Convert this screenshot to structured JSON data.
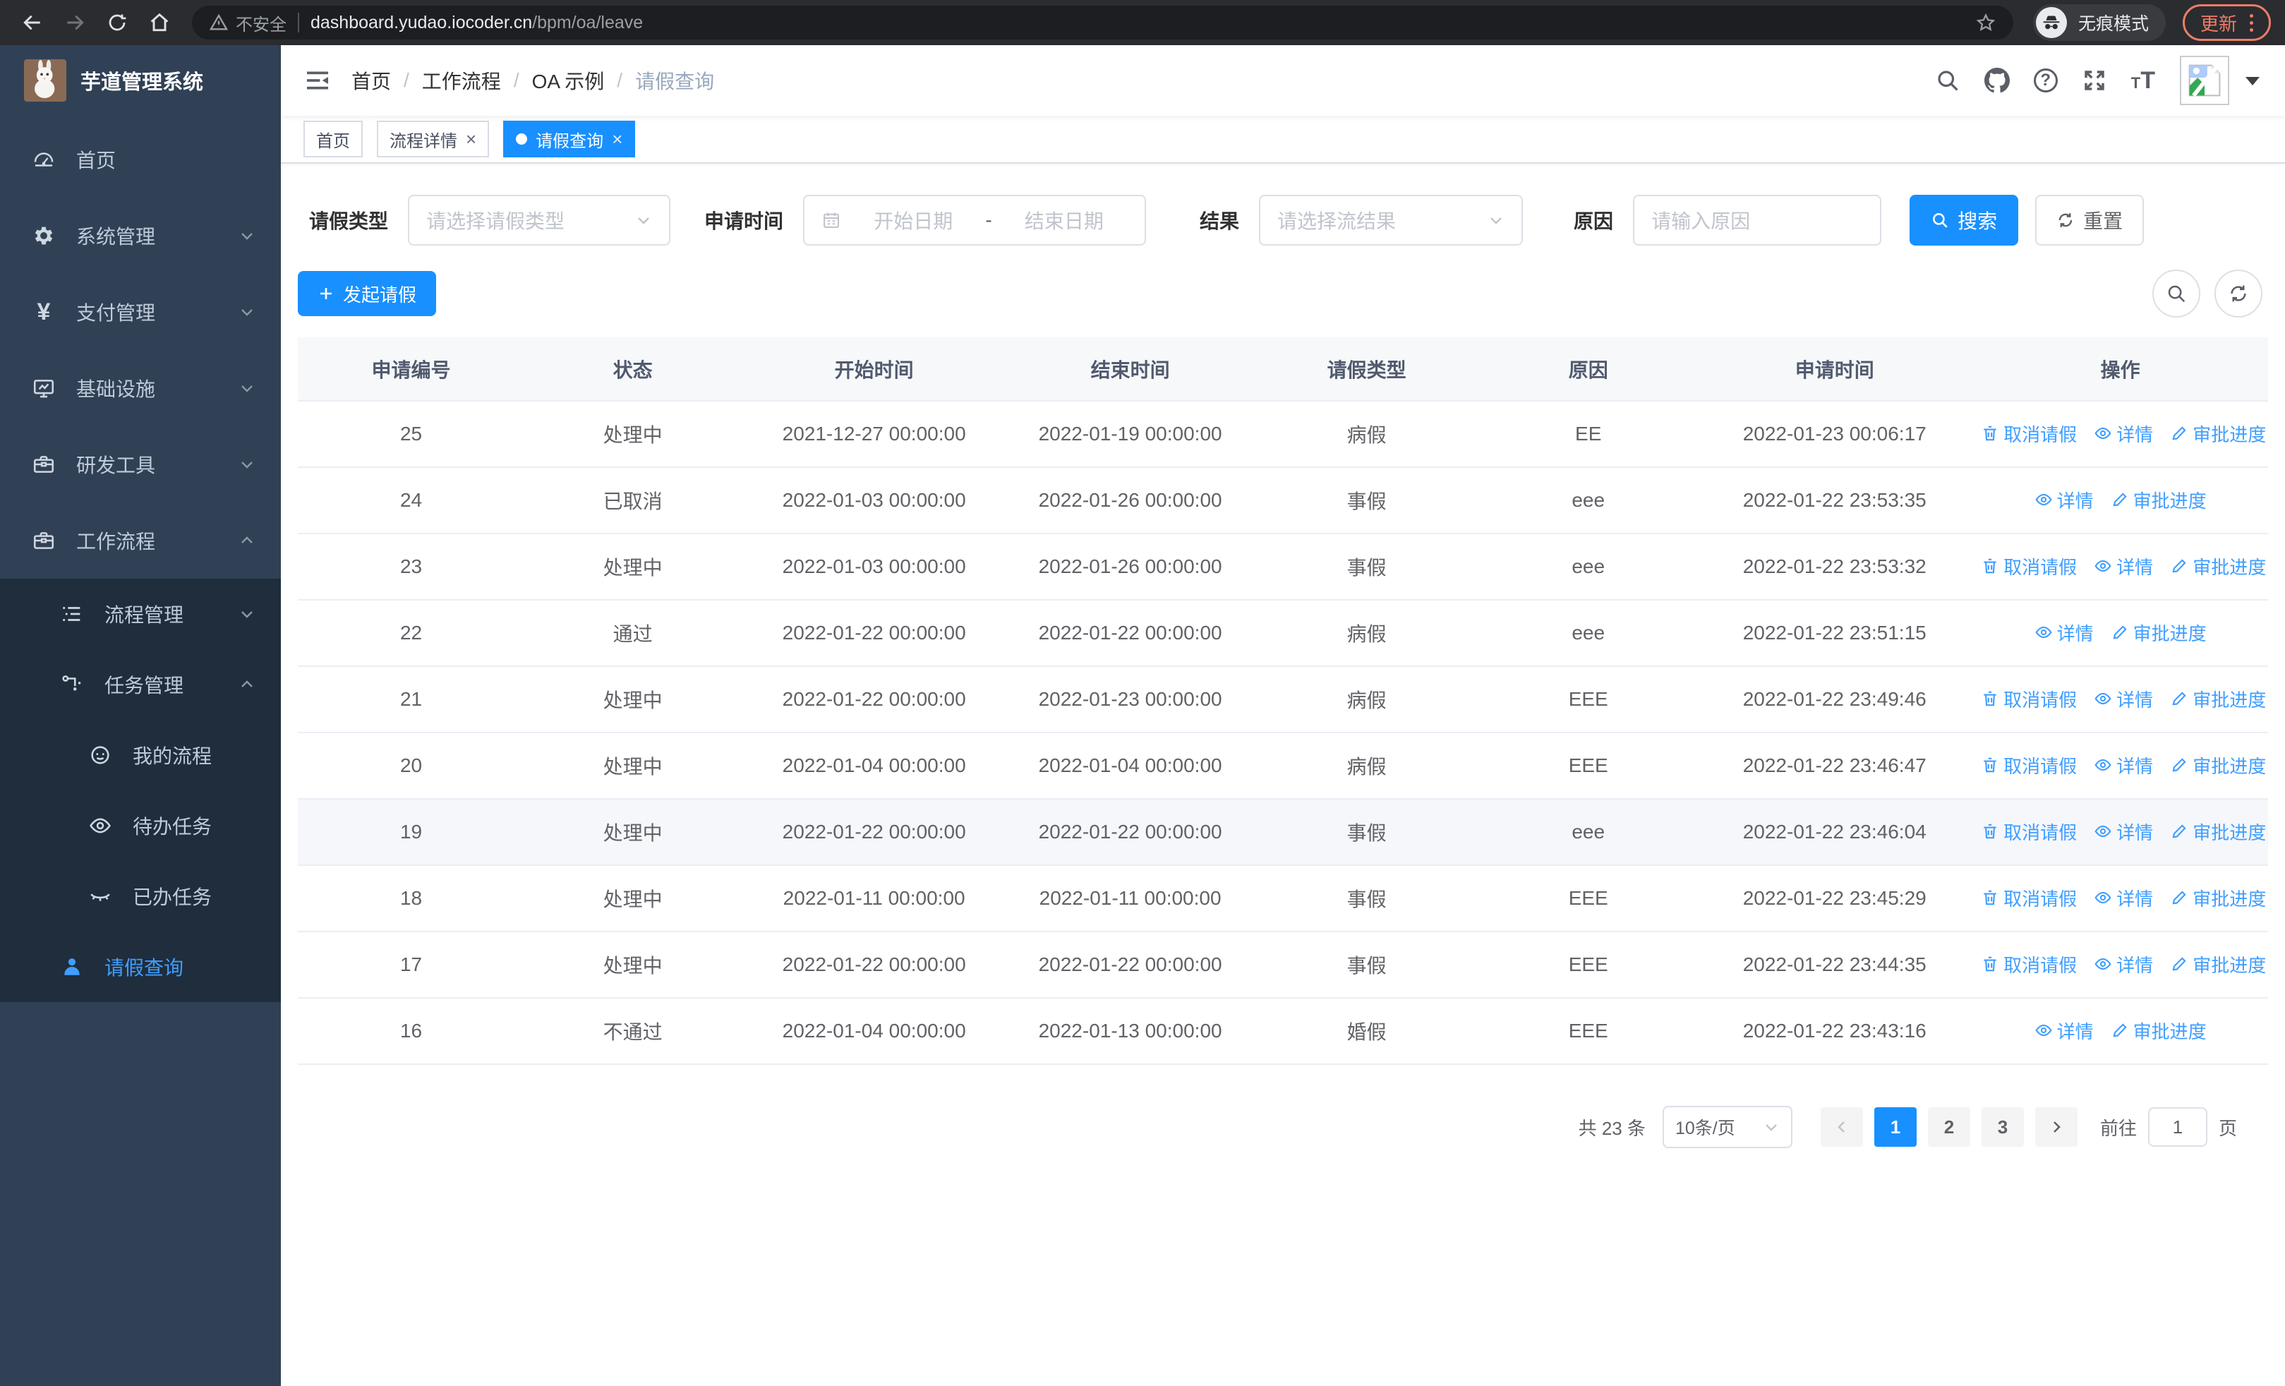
{
  "browser": {
    "security_label": "不安全",
    "url_host": "dashboard.yudao.iocoder.cn",
    "url_path": "/bpm/oa/leave",
    "incognito_label": "无痕模式",
    "update_label": "更新"
  },
  "sidebar": {
    "title": "芋道管理系统",
    "items": [
      {
        "label": "首页"
      },
      {
        "label": "系统管理"
      },
      {
        "label": "支付管理"
      },
      {
        "label": "基础设施"
      },
      {
        "label": "研发工具"
      },
      {
        "label": "工作流程"
      }
    ],
    "submenu": [
      {
        "label": "流程管理"
      },
      {
        "label": "任务管理"
      },
      {
        "label": "我的流程"
      },
      {
        "label": "待办任务"
      },
      {
        "label": "已办任务"
      },
      {
        "label": "请假查询"
      }
    ]
  },
  "breadcrumb": {
    "items": [
      "首页",
      "工作流程",
      "OA 示例",
      "请假查询"
    ]
  },
  "tabs": [
    {
      "label": "首页"
    },
    {
      "label": "流程详情"
    },
    {
      "label": "请假查询"
    }
  ],
  "filters": {
    "leave_type": {
      "label": "请假类型",
      "placeholder": "请选择请假类型"
    },
    "apply_time": {
      "label": "申请时间",
      "start_placeholder": "开始日期",
      "separator": "-",
      "end_placeholder": "结束日期"
    },
    "result": {
      "label": "结果",
      "placeholder": "请选择流结果"
    },
    "reason": {
      "label": "原因",
      "placeholder": "请输入原因"
    },
    "search_label": "搜索",
    "reset_label": "重置"
  },
  "toolbar": {
    "create_label": "发起请假"
  },
  "table": {
    "columns": [
      "申请编号",
      "状态",
      "开始时间",
      "结束时间",
      "请假类型",
      "原因",
      "申请时间",
      "操作"
    ],
    "rows": [
      {
        "id": "25",
        "status": "处理中",
        "start_time": "2021-12-27 00:00:00",
        "end_time": "2022-01-19 00:00:00",
        "leave_type": "病假",
        "reason": "EE",
        "apply_time": "2022-01-23 00:06:17",
        "actions": [
          {
            "name": "cancel-leave-link",
            "icon": "delete-icon",
            "label": "取消请假"
          },
          {
            "name": "detail-link",
            "icon": "view-icon",
            "label": "详情"
          },
          {
            "name": "approve-progress-link",
            "icon": "edit-icon",
            "label": "审批进度"
          }
        ]
      },
      {
        "id": "24",
        "status": "已取消",
        "start_time": "2022-01-03 00:00:00",
        "end_time": "2022-01-26 00:00:00",
        "leave_type": "事假",
        "reason": "eee",
        "apply_time": "2022-01-22 23:53:35",
        "actions": [
          {
            "name": "detail-link",
            "icon": "view-icon",
            "label": "详情"
          },
          {
            "name": "approve-progress-link",
            "icon": "edit-icon",
            "label": "审批进度"
          }
        ]
      },
      {
        "id": "23",
        "status": "处理中",
        "start_time": "2022-01-03 00:00:00",
        "end_time": "2022-01-26 00:00:00",
        "leave_type": "事假",
        "reason": "eee",
        "apply_time": "2022-01-22 23:53:32",
        "actions": [
          {
            "name": "cancel-leave-link",
            "icon": "delete-icon",
            "label": "取消请假"
          },
          {
            "name": "detail-link",
            "icon": "view-icon",
            "label": "详情"
          },
          {
            "name": "approve-progress-link",
            "icon": "edit-icon",
            "label": "审批进度"
          }
        ]
      },
      {
        "id": "22",
        "status": "通过",
        "start_time": "2022-01-22 00:00:00",
        "end_time": "2022-01-22 00:00:00",
        "leave_type": "病假",
        "reason": "eee",
        "apply_time": "2022-01-22 23:51:15",
        "actions": [
          {
            "name": "detail-link",
            "icon": "view-icon",
            "label": "详情"
          },
          {
            "name": "approve-progress-link",
            "icon": "edit-icon",
            "label": "审批进度"
          }
        ]
      },
      {
        "id": "21",
        "status": "处理中",
        "start_time": "2022-01-22 00:00:00",
        "end_time": "2022-01-23 00:00:00",
        "leave_type": "病假",
        "reason": "EEE",
        "apply_time": "2022-01-22 23:49:46",
        "actions": [
          {
            "name": "cancel-leave-link",
            "icon": "delete-icon",
            "label": "取消请假"
          },
          {
            "name": "detail-link",
            "icon": "view-icon",
            "label": "详情"
          },
          {
            "name": "approve-progress-link",
            "icon": "edit-icon",
            "label": "审批进度"
          }
        ]
      },
      {
        "id": "20",
        "status": "处理中",
        "start_time": "2022-01-04 00:00:00",
        "end_time": "2022-01-04 00:00:00",
        "leave_type": "病假",
        "reason": "EEE",
        "apply_time": "2022-01-22 23:46:47",
        "actions": [
          {
            "name": "cancel-leave-link",
            "icon": "delete-icon",
            "label": "取消请假"
          },
          {
            "name": "detail-link",
            "icon": "view-icon",
            "label": "详情"
          },
          {
            "name": "approve-progress-link",
            "icon": "edit-icon",
            "label": "审批进度"
          }
        ]
      },
      {
        "id": "19",
        "status": "处理中",
        "start_time": "2022-01-22 00:00:00",
        "end_time": "2022-01-22 00:00:00",
        "leave_type": "事假",
        "reason": "eee",
        "apply_time": "2022-01-22 23:46:04",
        "highlight": true,
        "actions": [
          {
            "name": "cancel-leave-link",
            "icon": "delete-icon",
            "label": "取消请假"
          },
          {
            "name": "detail-link",
            "icon": "view-icon",
            "label": "详情"
          },
          {
            "name": "approve-progress-link",
            "icon": "edit-icon",
            "label": "审批进度"
          }
        ]
      },
      {
        "id": "18",
        "status": "处理中",
        "start_time": "2022-01-11 00:00:00",
        "end_time": "2022-01-11 00:00:00",
        "leave_type": "事假",
        "reason": "EEE",
        "apply_time": "2022-01-22 23:45:29",
        "actions": [
          {
            "name": "cancel-leave-link",
            "icon": "delete-icon",
            "label": "取消请假"
          },
          {
            "name": "detail-link",
            "icon": "view-icon",
            "label": "详情"
          },
          {
            "name": "approve-progress-link",
            "icon": "edit-icon",
            "label": "审批进度"
          }
        ]
      },
      {
        "id": "17",
        "status": "处理中",
        "start_time": "2022-01-22 00:00:00",
        "end_time": "2022-01-22 00:00:00",
        "leave_type": "事假",
        "reason": "EEE",
        "apply_time": "2022-01-22 23:44:35",
        "actions": [
          {
            "name": "cancel-leave-link",
            "icon": "delete-icon",
            "label": "取消请假"
          },
          {
            "name": "detail-link",
            "icon": "view-icon",
            "label": "详情"
          },
          {
            "name": "approve-progress-link",
            "icon": "edit-icon",
            "label": "审批进度"
          }
        ]
      },
      {
        "id": "16",
        "status": "不通过",
        "start_time": "2022-01-04 00:00:00",
        "end_time": "2022-01-13 00:00:00",
        "leave_type": "婚假",
        "reason": "EEE",
        "apply_time": "2022-01-22 23:43:16",
        "actions": [
          {
            "name": "detail-link",
            "icon": "view-icon",
            "label": "详情"
          },
          {
            "name": "approve-progress-link",
            "icon": "edit-icon",
            "label": "审批进度"
          }
        ]
      }
    ]
  },
  "pagination": {
    "total": "共 23 条",
    "page_size": "10条/页",
    "pages": [
      "1",
      "2",
      "3"
    ],
    "active_page": "1",
    "goto_label": "前往",
    "goto_value": "1",
    "unit": "页"
  }
}
